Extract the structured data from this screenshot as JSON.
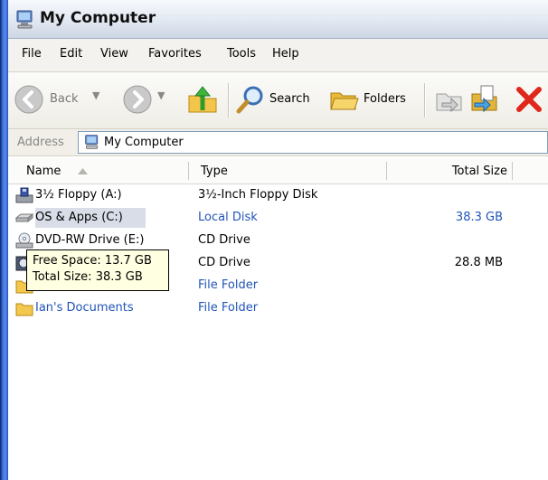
{
  "window": {
    "title": "My Computer"
  },
  "menu": [
    "File",
    "Edit",
    "View",
    "Favorites",
    "Tools",
    "Help"
  ],
  "toolbar": {
    "back_label": "Back",
    "search_label": "Search",
    "folders_label": "Folders"
  },
  "address": {
    "label": "Address",
    "value": "My Computer"
  },
  "columns": {
    "name": "Name",
    "type": "Type",
    "total_size": "Total Size"
  },
  "rows": [
    {
      "name": "3½ Floppy (A:)",
      "type": "3½-Inch Floppy Disk",
      "total_size": "",
      "icon": "floppy-drive-icon"
    },
    {
      "name": "OS & Apps (C:)",
      "type": "Local Disk",
      "total_size": "38.3 GB",
      "icon": "hard-disk-icon"
    },
    {
      "name": "DVD-RW Drive (E:)",
      "type": "CD Drive",
      "total_size": "",
      "icon": "dvd-drive-icon"
    },
    {
      "name": "",
      "type": "CD Drive",
      "total_size": "28.8 MB",
      "icon": "cd-drive-icon"
    },
    {
      "name": "",
      "type": "File Folder",
      "total_size": "",
      "icon": "folder-icon"
    },
    {
      "name": "Ian's Documents",
      "type": "File Folder",
      "total_size": "",
      "icon": "folder-icon"
    }
  ],
  "tooltip": {
    "line1": "Free Space: 13.7 GB",
    "line2": "Total Size: 38.3 GB"
  },
  "colors": {
    "link_blue": "#2154b8",
    "tooltip_bg": "#ffffe1",
    "frame_blue": "#2450c9",
    "delete_red": "#e0271b"
  }
}
